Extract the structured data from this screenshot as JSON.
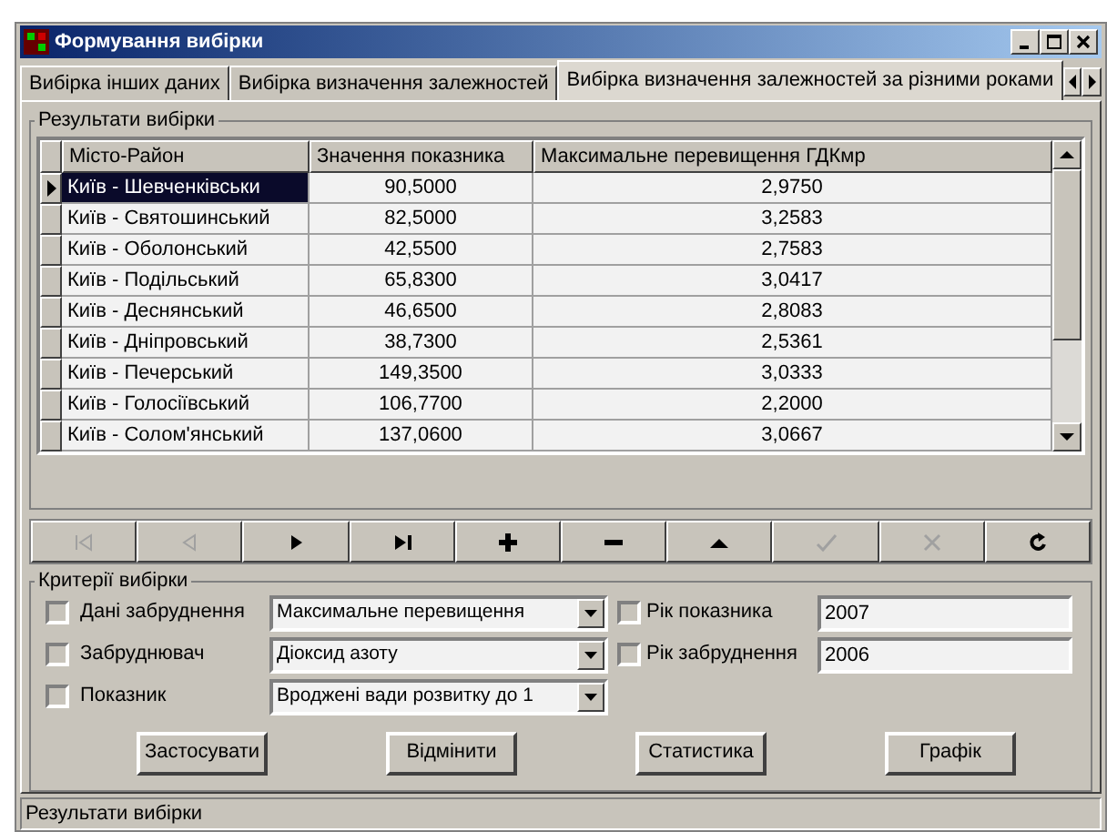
{
  "window": {
    "title": "Формування вибірки"
  },
  "tabs": [
    {
      "label": "Вибірка інших даних",
      "selected": false
    },
    {
      "label": "Вибірка визначення залежностей",
      "selected": false
    },
    {
      "label": "Вибірка визначення залежностей за різними роками",
      "selected": true
    }
  ],
  "results": {
    "title": "Результати вибірки",
    "columns": [
      "Місто-Район",
      "Значення показника",
      "Максимальне перевищення  ГДКмр"
    ],
    "rows": [
      {
        "cells": [
          "Київ - Шевченківськи",
          "90,5000",
          "2,9750"
        ],
        "selected": true
      },
      {
        "cells": [
          "Київ - Святошинський",
          "82,5000",
          "3,2583"
        ],
        "selected": false
      },
      {
        "cells": [
          "Київ - Оболонський",
          "42,5500",
          "2,7583"
        ],
        "selected": false
      },
      {
        "cells": [
          "Київ - Подільський",
          "65,8300",
          "3,0417"
        ],
        "selected": false
      },
      {
        "cells": [
          "Київ - Деснянський",
          "46,6500",
          "2,8083"
        ],
        "selected": false
      },
      {
        "cells": [
          "Київ - Дніпровський",
          "38,7300",
          "2,5361"
        ],
        "selected": false
      },
      {
        "cells": [
          "Київ - Печерський",
          "149,3500",
          "3,0333"
        ],
        "selected": false
      },
      {
        "cells": [
          "Київ - Голосіївський",
          "106,7700",
          "2,2000"
        ],
        "selected": false
      },
      {
        "cells": [
          "Київ - Солом'янський",
          "137,0600",
          "3,0667"
        ],
        "selected": false
      }
    ]
  },
  "navigator": [
    {
      "kind": "first",
      "disabled": true
    },
    {
      "kind": "prior",
      "disabled": true
    },
    {
      "kind": "next",
      "disabled": false
    },
    {
      "kind": "last",
      "disabled": false
    },
    {
      "kind": "insert",
      "disabled": false
    },
    {
      "kind": "delete",
      "disabled": false
    },
    {
      "kind": "edit",
      "disabled": false
    },
    {
      "kind": "post",
      "disabled": true
    },
    {
      "kind": "cancel",
      "disabled": true
    },
    {
      "kind": "refresh",
      "disabled": false
    }
  ],
  "criteria": {
    "title": "Критерії вибірки",
    "left": [
      {
        "label": "Дані забруднення",
        "checked": false,
        "value": "Максимальне перевищення"
      },
      {
        "label": "Забруднювач",
        "checked": false,
        "value": "Діоксид азоту"
      },
      {
        "label": "Показник",
        "checked": false,
        "value": "Вроджені вади розвитку до 1"
      }
    ],
    "right": [
      {
        "label": "Рік показника",
        "checked": false,
        "value": "2007"
      },
      {
        "label": "Рік забруднення",
        "checked": false,
        "value": "2006"
      }
    ]
  },
  "buttons": [
    "Застосувати",
    "Відмінити",
    "Статистика",
    "Графік"
  ],
  "status_bar": "Результати вибірки"
}
